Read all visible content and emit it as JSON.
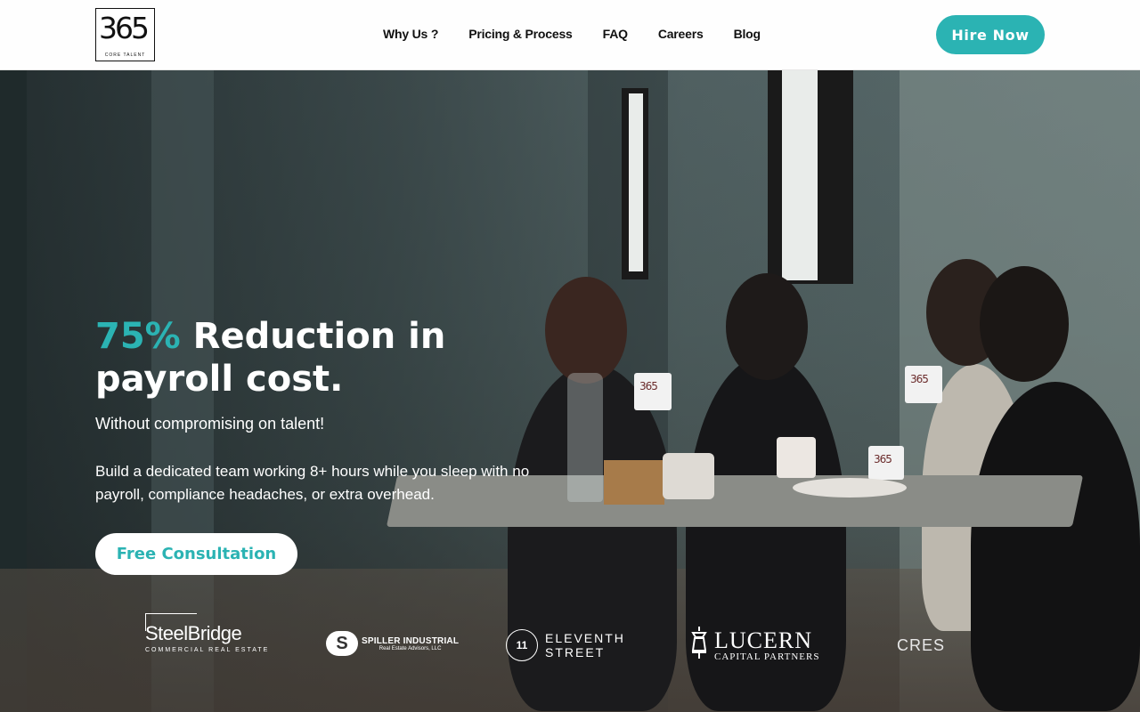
{
  "header": {
    "logo": {
      "number": "365",
      "subtitle": "CORE TALENT"
    },
    "nav": [
      "Why Us ?",
      "Pricing & Process",
      "FAQ",
      "Careers",
      "Blog"
    ],
    "cta": "Hire Now"
  },
  "hero": {
    "headline_accent": "75%",
    "headline_rest": " Reduction in payroll cost.",
    "subheading": "Without compromising on talent!",
    "description": "Build a dedicated team working 8+ hours while you sleep with no payroll, compliance headaches, or extra overhead.",
    "cta": "Free Consultation",
    "mug_logo": "365"
  },
  "client_logos": {
    "steelbridge": {
      "name": "SteelBridge",
      "sub": "COMMERCIAL REAL ESTATE"
    },
    "spiller": {
      "mark": "S",
      "name": "SPILLER INDUSTRIAL",
      "sub": "Real Estate Advisors, LLC"
    },
    "eleventh": {
      "mark": "11",
      "line1": "ELEVENTH",
      "line2": "STREET"
    },
    "lucern": {
      "name": "LUCERN",
      "sub": "CAPITAL PARTNERS"
    },
    "cres": {
      "name": "CRES"
    }
  },
  "colors": {
    "accent": "#2bb3b3",
    "header_bg": "#fefefe",
    "text_dark": "#111111"
  }
}
